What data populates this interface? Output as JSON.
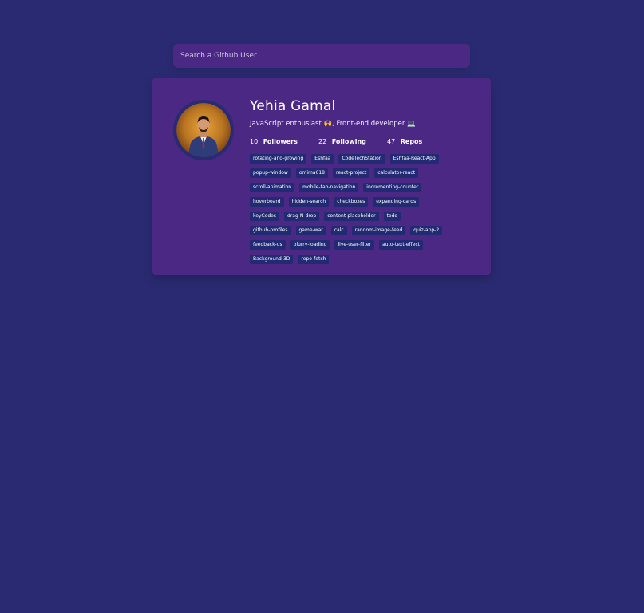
{
  "search": {
    "placeholder": "Search a Github User",
    "value": ""
  },
  "profile": {
    "name": "Yehia Gamal",
    "bio": "JavaScript enthusiast 🙌, Front-end developer 💻",
    "stats": [
      {
        "value": "10",
        "label": "Followers"
      },
      {
        "value": "22",
        "label": "Following"
      },
      {
        "value": "47",
        "label": "Repos"
      }
    ],
    "repos": [
      "rotating-and-growing",
      "Eshfaa",
      "CodeTechStation",
      "Eshfaa-React-App",
      "popup-window",
      "omima618",
      "react-project",
      "calculator-react",
      "scroll-animation",
      "mobile-tab-navigation",
      "incrementing-counter",
      "hoverboard",
      "hidden-search",
      "checkboxes",
      "expanding-cards",
      "keyCodes",
      "drag-N-drop",
      "content-placeholder",
      "todo",
      "github-profiles",
      "game-war",
      "calc",
      "random-image-feed",
      "quiz-app-2",
      "feedback-us",
      "blurry-loading",
      "live-user-filter",
      "auto-text-effect",
      "Background-3D",
      "repo-fetch"
    ]
  },
  "colors": {
    "background": "#2a2a72",
    "card": "#4c2885",
    "repo_tag": "#212a72"
  }
}
